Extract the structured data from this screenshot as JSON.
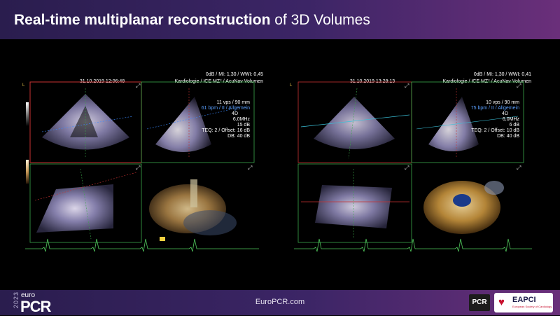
{
  "slide": {
    "title_bold": "Real-time multiplanar reconstruction",
    "title_rest": " of 3D Volumes",
    "footer_url": "EuroPCR.com",
    "logo_year": "2023",
    "logo_euro": "euro",
    "logo_pcr": "PCR",
    "pcr_badge": "PCR",
    "eapci_label": "EAPCI",
    "eapci_sub": "European Society of Cardiology"
  },
  "panel_left": {
    "datetime": "31.10.2019 12:06:48",
    "header_line1": "0dB / MI: 1,30 / WWI: 0,45",
    "header_line2": "Kardiologie / ICE MZ° / AcuNav Volumen",
    "param_1": "11 vps / 90 mm",
    "param_2": "61 bpm / II / Allgemein",
    "param_3": "4D",
    "param_4": "6,0MHz",
    "param_5": "15 dB",
    "param_6": "TEQ: 2 / Offset: 16 dB",
    "param_7": "DB: 40 dB"
  },
  "panel_right": {
    "datetime": "31.10.2019 13:28:13",
    "header_line1": "0dB / MI: 1,30 / WWI: 0,41",
    "header_line2": "Kardiologie / ICE MZ° / AcuNav Volumen",
    "param_1": "10 vps / 90 mm",
    "param_2": "75 bpm / II / Allgemein",
    "param_3": "4D",
    "param_4": "6,0MHz",
    "param_5": "6 dB",
    "param_6": "TEQ: 2 / Offset: 10 dB",
    "param_7": "DB: 40 dB"
  },
  "colors": {
    "frame_green": "#3aa84a",
    "frame_red": "#c83232",
    "bpm_blue": "#5aa0ff",
    "ecg_green": "#4ec45a",
    "brand_purple": "#3c2566"
  },
  "icons": [
    "expand-icon",
    "ecg-trace",
    "heart-icon",
    "yellow-marker-icon"
  ]
}
